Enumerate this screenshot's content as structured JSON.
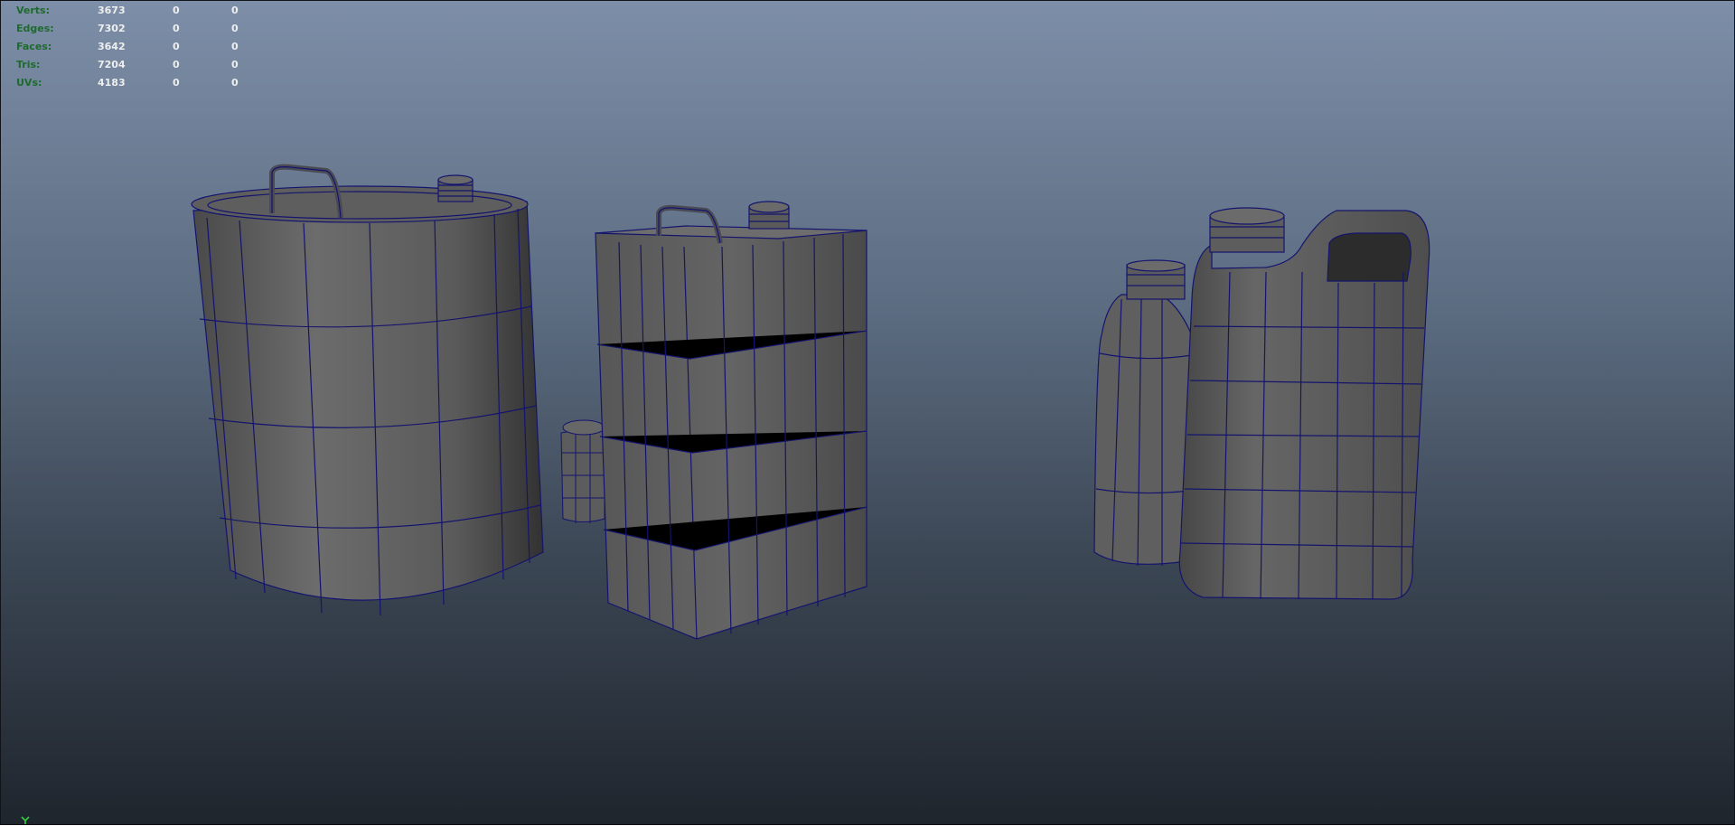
{
  "hud": {
    "rows": [
      {
        "label": "Verts:",
        "total": "3673",
        "selected": "0",
        "component": "0"
      },
      {
        "label": "Edges:",
        "total": "7302",
        "selected": "0",
        "component": "0"
      },
      {
        "label": "Faces:",
        "total": "3642",
        "selected": "0",
        "component": "0"
      },
      {
        "label": "Tris:",
        "total": "7204",
        "selected": "0",
        "component": "0"
      },
      {
        "label": "UVs:",
        "total": "4183",
        "selected": "0",
        "component": "0"
      }
    ]
  },
  "colors": {
    "wire": "#14146e",
    "mesh_light": "#6e6e6e",
    "mesh_mid": "#595959",
    "mesh_dark": "#3b3b3b",
    "hud_label": "#1d6b2c",
    "hud_value": "#eeeeee",
    "axis": "#30d040"
  },
  "scene": {
    "objects": [
      "round-oil-drum",
      "small-cap",
      "rectangular-oil-can",
      "small-bottle",
      "plastic-jerrycan"
    ]
  },
  "icons": {
    "axis": "axis-gizmo-icon"
  }
}
